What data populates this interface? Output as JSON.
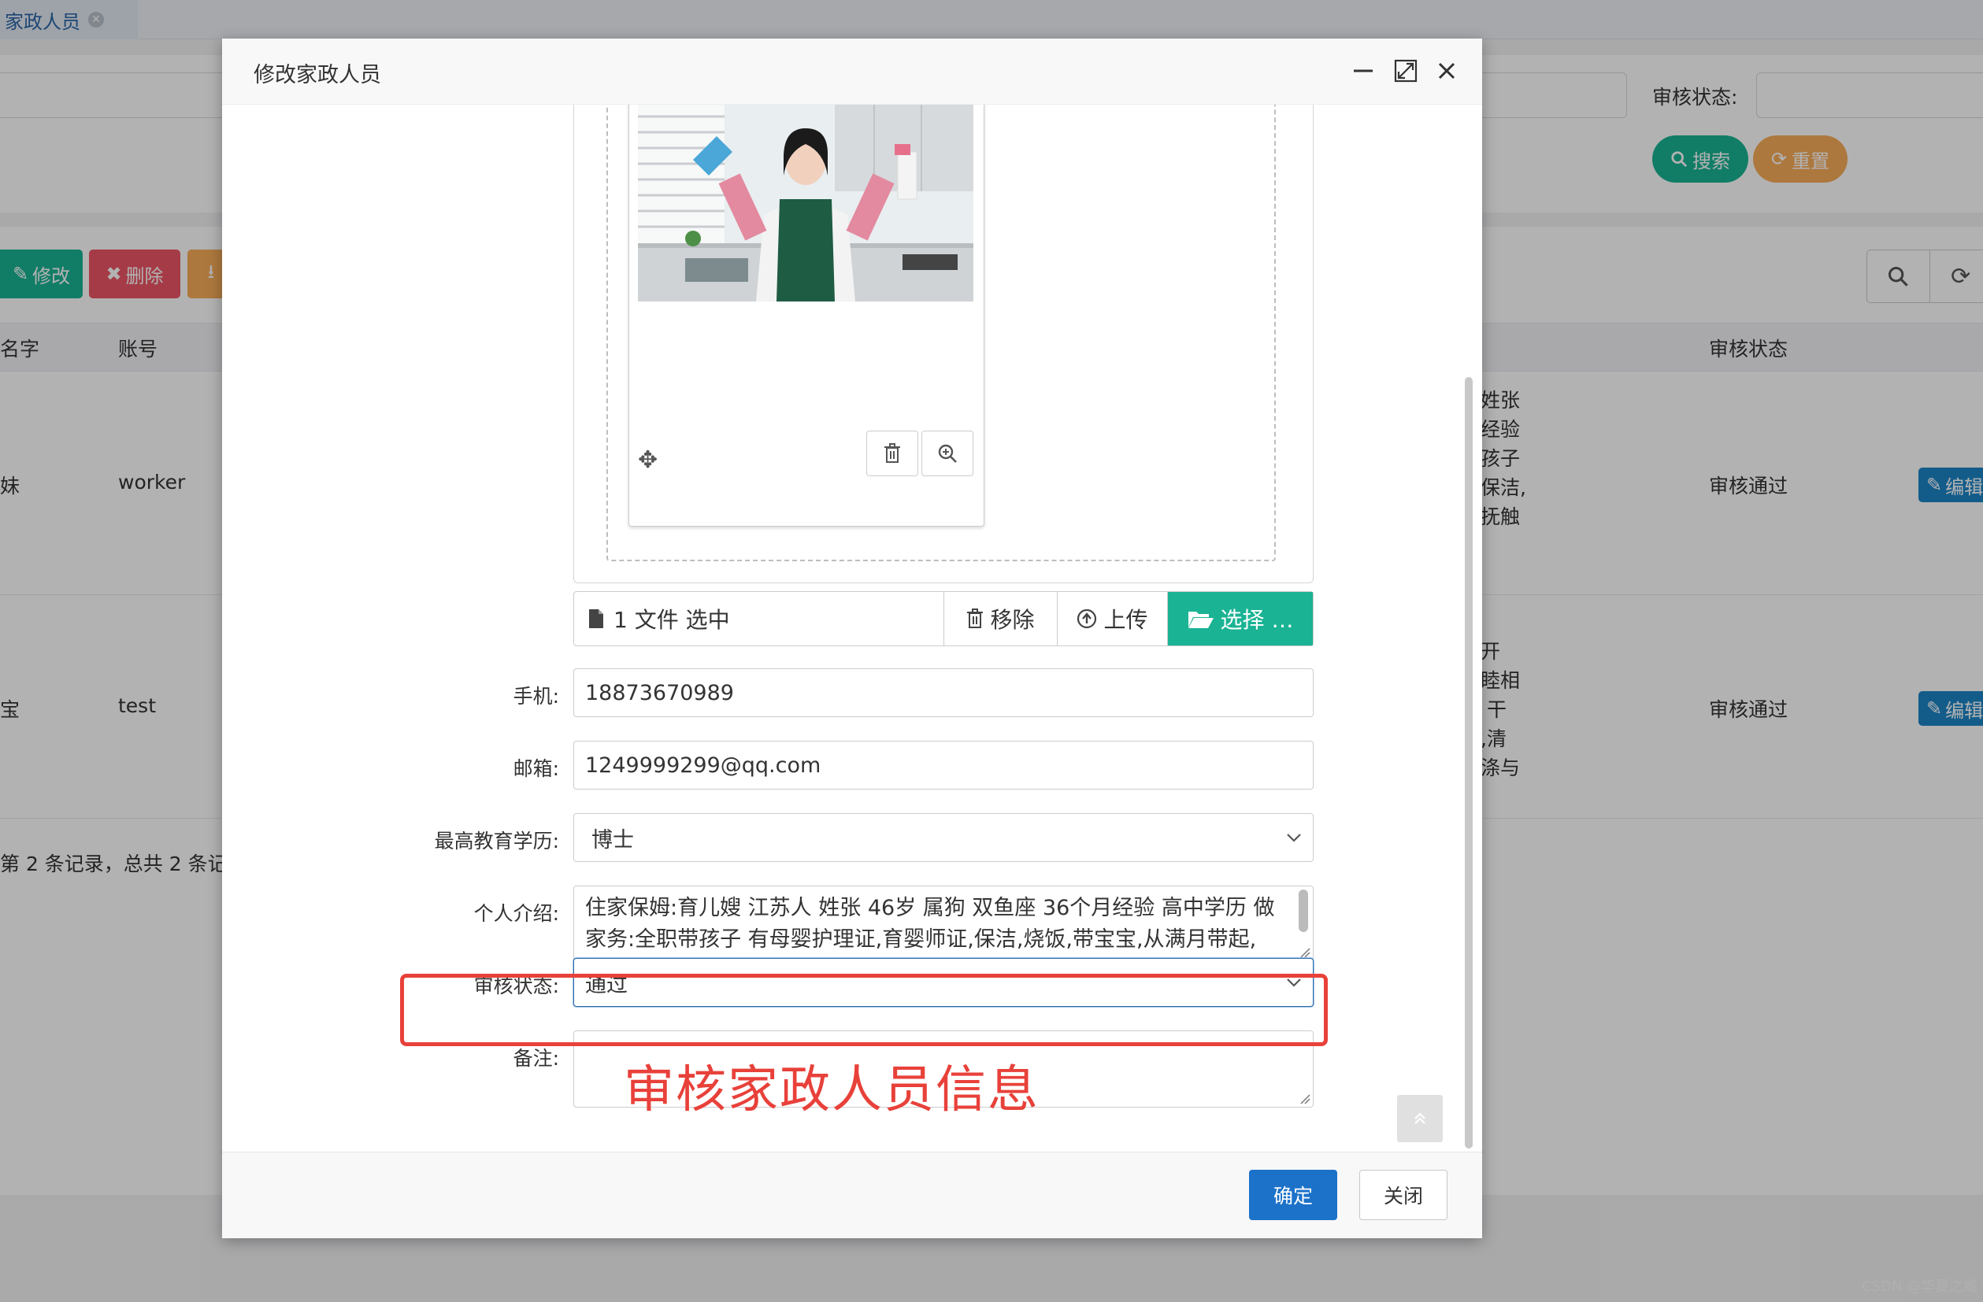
{
  "background": {
    "tab_label": "家政人员",
    "search_status_label": "审核状态:",
    "search_button": "搜索",
    "reset_button": "重置",
    "toolbar_edit": "修改",
    "toolbar_delete": "删除",
    "columns": {
      "name": "名字",
      "account": "账号",
      "status": "审核状态"
    },
    "rows": [
      {
        "name": "妹",
        "account": "worker",
        "intro_fragment": "姓张\n经验\n孩子\n保洁,\n抚触",
        "status": "审核通过",
        "action": "编辑"
      },
      {
        "name": "宝",
        "account": "test",
        "intro_fragment": "\n开\n睦相\n 干\n,清\n涤与",
        "status": "审核通过",
        "action": "编辑"
      }
    ],
    "pagination_text": "第 2 条记录，总共 2 条记"
  },
  "modal": {
    "title": "修改家政人员",
    "file_caption": "1 文件 选中",
    "file_remove": "移除",
    "file_upload": "上传",
    "file_choose": "选择 …",
    "phone_label": "手机:",
    "phone_value": "18873670989",
    "email_label": "邮箱:",
    "email_value": "1249999299@qq.com",
    "education_label": "最高教育学历:",
    "education_value": "博士",
    "intro_label": "个人介绍:",
    "intro_value": "住家保姆:育儿嫂 江苏人 姓张 46岁 属狗 双鱼座 36个月经验 高中学历 做家务:全职带孩子 有母婴护理证,育婴师证,保洁,烧饭,带宝宝,从满月带起,",
    "status_label": "审核状态:",
    "status_value": "通过",
    "remark_label": "备注:",
    "remark_value": "",
    "ok_button": "确定",
    "close_button": "关闭"
  },
  "annotation_text": "审核家政人员信息",
  "watermark": "CSDN @华夏之威",
  "colors": {
    "primary_green": "#1ab394",
    "primary_blue": "#1c72c9",
    "warning_orange": "#f8ac59",
    "danger_red": "#ed5565",
    "annotation_red": "#e8413a"
  }
}
